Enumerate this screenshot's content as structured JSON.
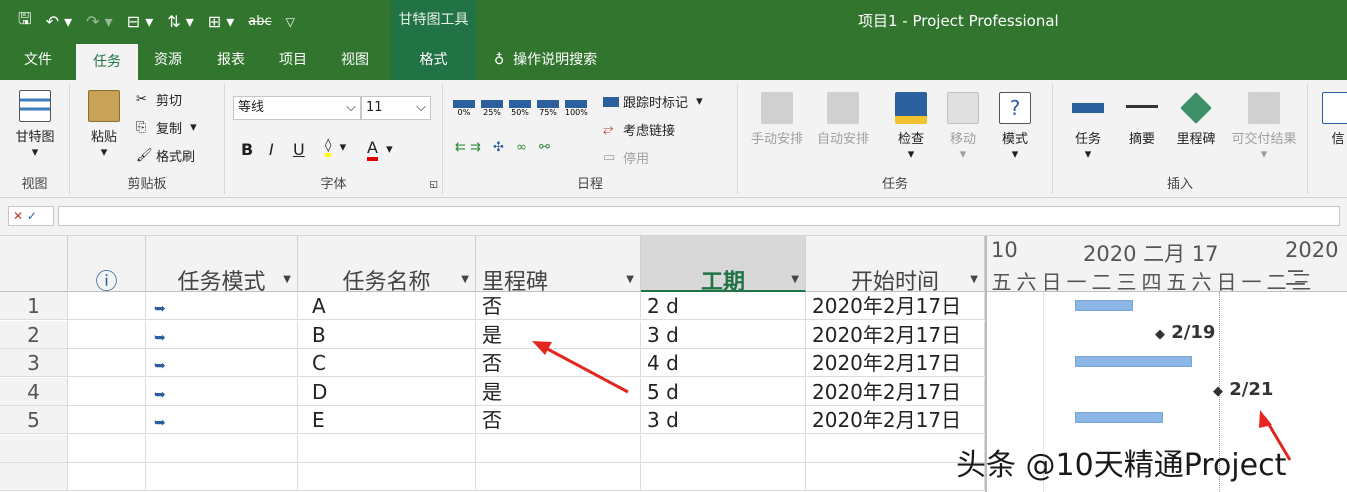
{
  "titlebar": {
    "context_tab": "甘特图工具",
    "title": "项目1  -  Project Professional"
  },
  "tabs": [
    "文件",
    "任务",
    "资源",
    "报表",
    "项目",
    "视图",
    "格式"
  ],
  "tellme": "操作说明搜索",
  "ribbon": {
    "view": {
      "gantt": "甘特图",
      "label": "视图"
    },
    "clipboard": {
      "paste": "粘贴",
      "cut": "剪切",
      "copy": "复制",
      "painter": "格式刷",
      "label": "剪贴板"
    },
    "font": {
      "name": "等线",
      "size": "11",
      "bold": "B",
      "italic": "I",
      "underline": "U",
      "label": "字体"
    },
    "schedule": {
      "pcts": [
        "0%",
        "25%",
        "50%",
        "75%",
        "100%"
      ],
      "track": "跟踪时标记",
      "respect": "考虑链接",
      "inactivate": "停用",
      "label": "日程"
    },
    "tasks": {
      "manual": "手动安排",
      "auto": "自动安排",
      "inspect": "检查",
      "move": "移动",
      "mode": "模式",
      "label": "任务"
    },
    "insert": {
      "task": "任务",
      "summary": "摘要",
      "milestone": "里程碑",
      "deliverable": "可交付结果",
      "label": "插入"
    },
    "info": "信"
  },
  "columns": {
    "mode": "任务模式",
    "name": "任务名称",
    "milestone": "里程碑",
    "duration": "工期",
    "start": "开始时间"
  },
  "rows": [
    {
      "num": "1",
      "name": "A",
      "milestone": "否",
      "duration": "2 d",
      "start": "2020年2月17日"
    },
    {
      "num": "2",
      "name": "B",
      "milestone": "是",
      "duration": "3 d",
      "start": "2020年2月17日"
    },
    {
      "num": "3",
      "name": "C",
      "milestone": "否",
      "duration": "4 d",
      "start": "2020年2月17日"
    },
    {
      "num": "4",
      "name": "D",
      "milestone": "是",
      "duration": "5 d",
      "start": "2020年2月17日"
    },
    {
      "num": "5",
      "name": "E",
      "milestone": "否",
      "duration": "3 d",
      "start": "2020年2月17日"
    }
  ],
  "gantt": {
    "week0": "10",
    "week1": "2020 二月 17",
    "week2": "2020 二",
    "days": [
      "五",
      "六",
      "日",
      "一",
      "二",
      "三",
      "四",
      "五",
      "六",
      "日",
      "一",
      "二",
      "三"
    ],
    "ms1": "2/19",
    "ms2": "2/21"
  },
  "watermark": "头条 @10天精通Project"
}
